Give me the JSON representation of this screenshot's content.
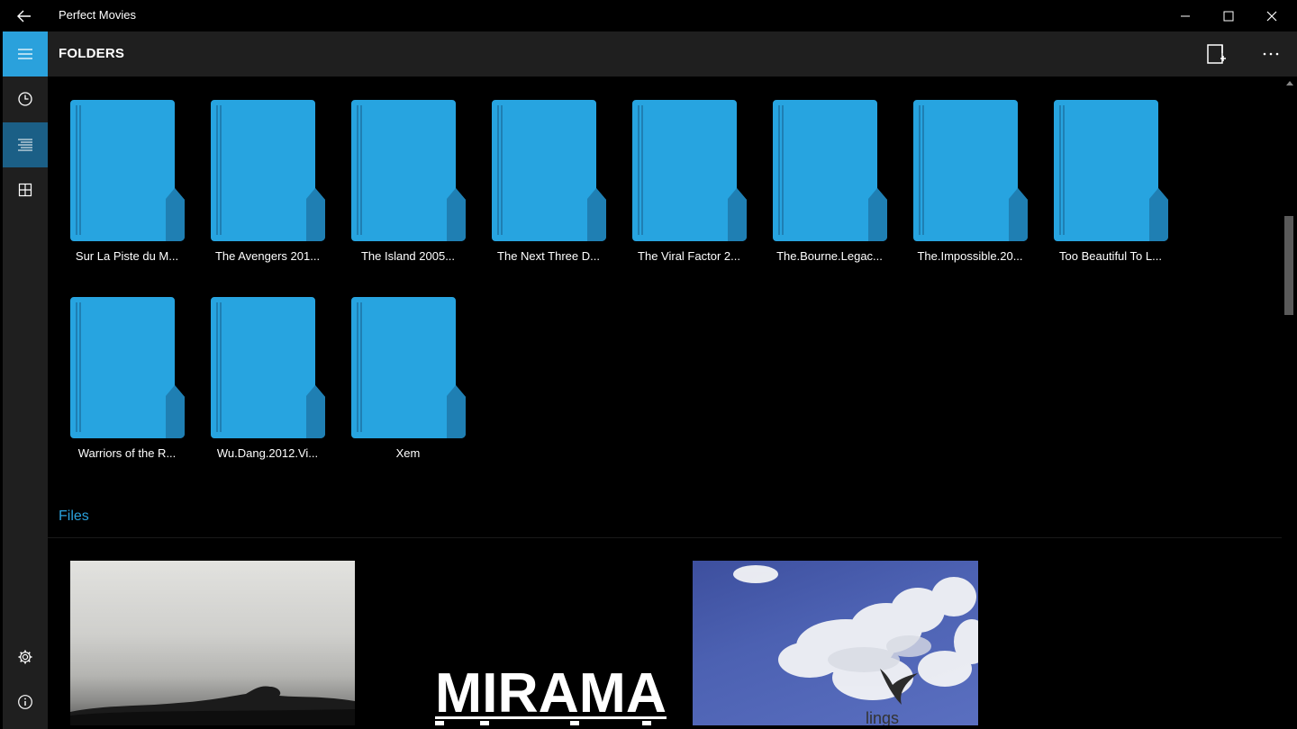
{
  "window": {
    "title": "Perfect Movies",
    "back_icon": "back-arrow-icon",
    "controls": [
      "minimize-icon",
      "maximize-icon",
      "close-icon"
    ]
  },
  "header": {
    "title": "FOLDERS",
    "actions": [
      "new-folder-icon",
      "more-icon"
    ]
  },
  "rail": {
    "items": [
      "hamburger-icon",
      "clock-icon",
      "list-icon",
      "grid-icon"
    ],
    "bottom": [
      "gear-icon",
      "info-icon"
    ],
    "active": "list-icon"
  },
  "folders": [
    {
      "label": "Sur La Piste du M..."
    },
    {
      "label": "The Avengers 201..."
    },
    {
      "label": "The Island 2005..."
    },
    {
      "label": "The Next Three D..."
    },
    {
      "label": "The Viral Factor 2..."
    },
    {
      "label": "The.Bourne.Legac..."
    },
    {
      "label": "The.Impossible.20..."
    },
    {
      "label": "Too Beautiful To L..."
    },
    {
      "label": "Warriors of the R..."
    },
    {
      "label": "Wu.Dang.2012.Vi..."
    },
    {
      "label": "Xem"
    }
  ],
  "files": {
    "title": "Files",
    "thumbnails": [
      {
        "name": "grayscale-landscape"
      },
      {
        "name": "miramax-logo",
        "text": "MIRAMA"
      },
      {
        "name": "sky-clouds-logo",
        "text": "lings"
      }
    ]
  },
  "colors": {
    "accent": "#2aa1dc",
    "folder": "#27a4e0",
    "folder_dark": "#1f7fb3",
    "rail_bg": "#1f1f1f",
    "active_item": "#1b5f86"
  }
}
